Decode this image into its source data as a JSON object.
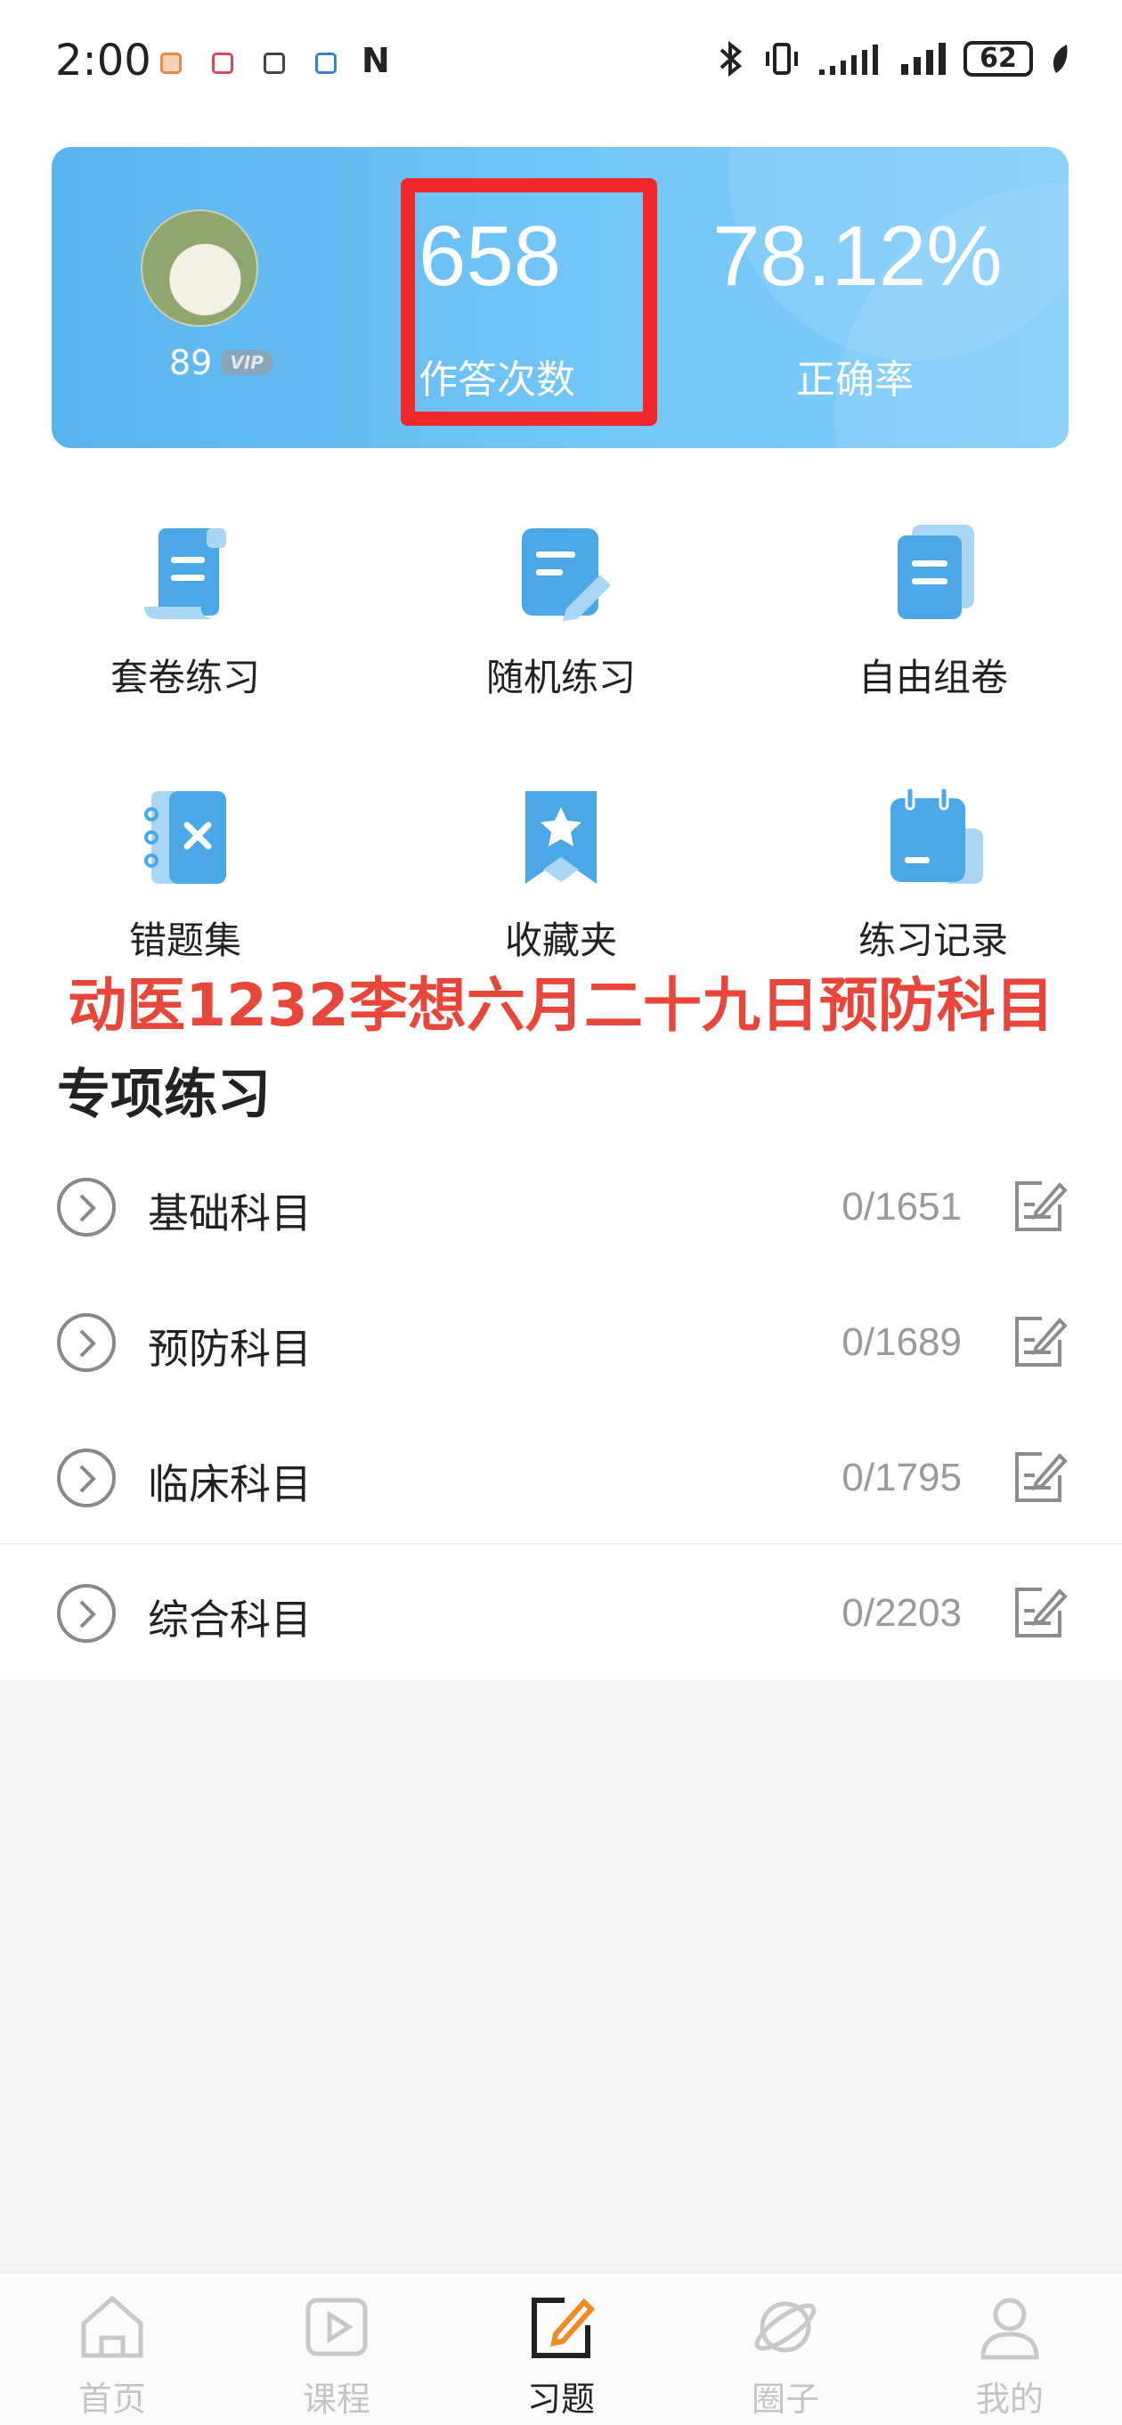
{
  "status_bar": {
    "time": "2:00",
    "nfc": "N",
    "battery": "62"
  },
  "stats": {
    "level": "89",
    "vip_badge": "VIP",
    "answer_count": "658",
    "answer_count_label": "作答次数",
    "accuracy": "78.12%",
    "accuracy_label": "正确率"
  },
  "features": [
    {
      "label": "套卷练习",
      "icon": "scroll-icon"
    },
    {
      "label": "随机练习",
      "icon": "edit-note-icon"
    },
    {
      "label": "自由组卷",
      "icon": "stacked-docs-icon"
    },
    {
      "label": "错题集",
      "icon": "wrong-notebook-icon"
    },
    {
      "label": "收藏夹",
      "icon": "bookmark-star-icon"
    },
    {
      "label": "练习记录",
      "icon": "notepad-icon"
    }
  ],
  "watermark_text": "动医1232李想六月二十九日预防科目",
  "section_title": "专项练习",
  "subjects": [
    {
      "label": "基础科目",
      "count": "0/1651"
    },
    {
      "label": "预防科目",
      "count": "0/1689"
    },
    {
      "label": "临床科目",
      "count": "0/1795"
    },
    {
      "label": "综合科目",
      "count": "0/2203"
    }
  ],
  "nav": [
    {
      "label": "首页",
      "icon": "home-icon"
    },
    {
      "label": "课程",
      "icon": "play-icon"
    },
    {
      "label": "习题",
      "icon": "edit-icon",
      "active": true
    },
    {
      "label": "圈子",
      "icon": "planet-icon"
    },
    {
      "label": "我的",
      "icon": "user-icon"
    }
  ],
  "colors": {
    "accent_blue": "#4aa8e6",
    "highlight_red": "#f0282d",
    "watermark_red": "#e8463a",
    "nav_active_orange": "#f08a24"
  }
}
